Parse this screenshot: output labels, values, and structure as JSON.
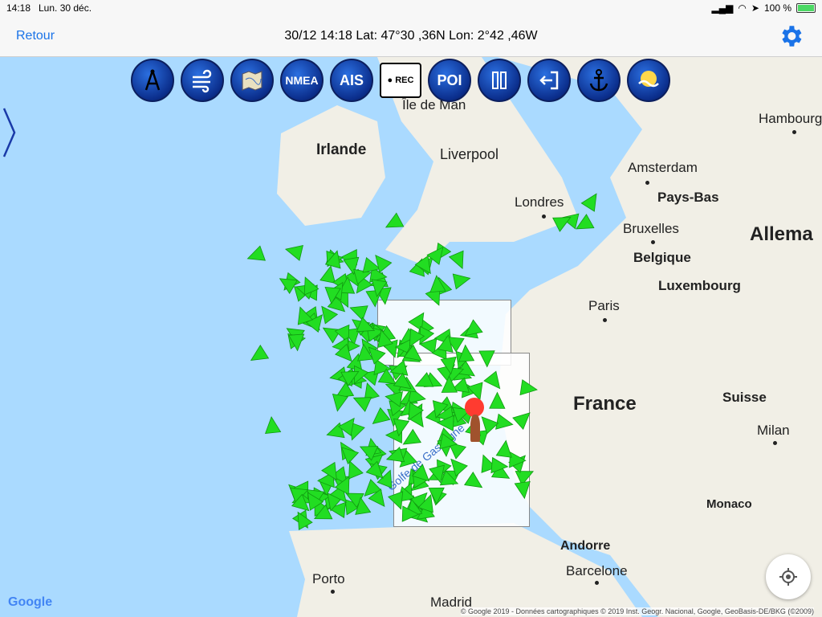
{
  "status_bar": {
    "time": "14:18",
    "date": "Lun. 30 déc.",
    "battery": "100 %",
    "battery_level": 1.0
  },
  "nav": {
    "back_label": "Retour",
    "coordinates": "30/12 14:18  Lat: 47°30 ,36N Lon: 2°42 ,46W"
  },
  "toolbar": {
    "items": [
      {
        "name": "compass-icon",
        "label": ""
      },
      {
        "name": "wind-icon",
        "label": ""
      },
      {
        "name": "chart-map-icon",
        "label": ""
      },
      {
        "name": "nmea-button",
        "label": "NMEA"
      },
      {
        "name": "ais-button",
        "label": "AIS"
      },
      {
        "name": "rec-button",
        "label": "● REC"
      },
      {
        "name": "poi-button",
        "label": "POI"
      },
      {
        "name": "pause-icon",
        "label": ""
      },
      {
        "name": "exit-icon",
        "label": ""
      },
      {
        "name": "anchor-icon",
        "label": ""
      },
      {
        "name": "tide-icon",
        "label": ""
      }
    ]
  },
  "map": {
    "places": [
      {
        "name": "Île de Man"
      },
      {
        "name": "Irlande"
      },
      {
        "name": "Liverpool"
      },
      {
        "name": "Hambourg"
      },
      {
        "name": "Amsterdam"
      },
      {
        "name": "Pays-Bas"
      },
      {
        "name": "Londres"
      },
      {
        "name": "Bruxelles"
      },
      {
        "name": "Belgique"
      },
      {
        "name": "Allema"
      },
      {
        "name": "Luxembourg"
      },
      {
        "name": "Paris"
      },
      {
        "name": "France"
      },
      {
        "name": "Suisse"
      },
      {
        "name": "Milan"
      },
      {
        "name": "Monaco"
      },
      {
        "name": "Andorre"
      },
      {
        "name": "Barcelone"
      },
      {
        "name": "Porto"
      },
      {
        "name": "Madrid"
      }
    ],
    "chart_label": "Golfe de Gascogne",
    "google_logo": "Google",
    "copyright": "© Google 2019 - Données cartographiques © 2019 Inst. Geogr. Nacional, Google, GeoBasis-DE/BKG (©2009)"
  },
  "colors": {
    "accent": "#1a73e8",
    "ais_target": "#22dd22",
    "tool_blue": "#0b2e8c",
    "sea": "#aadaff",
    "land": "#f1efe6"
  }
}
